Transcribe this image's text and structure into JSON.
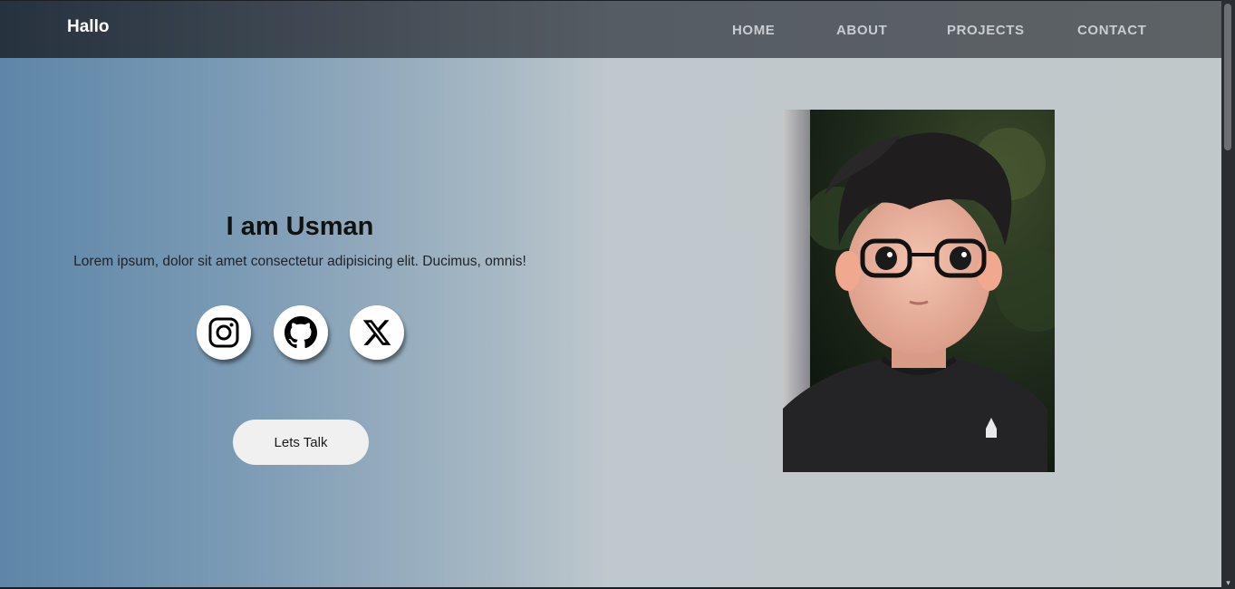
{
  "navbar": {
    "brand": "Hallo",
    "links": [
      {
        "label": "HOME"
      },
      {
        "label": "ABOUT"
      },
      {
        "label": "PROJECTS"
      },
      {
        "label": "CONTACT"
      }
    ]
  },
  "hero": {
    "title": "I am Usman",
    "description": "Lorem ipsum, dolor sit amet consectetur adipisicing elit. Ducimus, omnis!",
    "socials": [
      {
        "icon": "instagram-icon"
      },
      {
        "icon": "github-icon"
      },
      {
        "icon": "x-icon"
      }
    ],
    "cta_label": "Lets Talk"
  },
  "colors": {
    "navbar": "#3f4852",
    "hero_gradient_start": "#5d86a8",
    "hero_gradient_end": "#c1c8ca",
    "button_bg": "#f0f0f0"
  }
}
